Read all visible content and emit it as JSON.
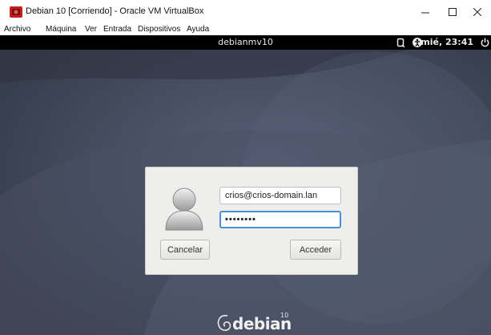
{
  "window": {
    "title": "Debian 10 [Corriendo] - Oracle VM VirtualBox",
    "controls": [
      "minimize-icon",
      "maximize-icon",
      "close-icon"
    ]
  },
  "menu": [
    "Archivo",
    "Máquina",
    "Ver",
    "Entrada",
    "Dispositivos",
    "Ayuda"
  ],
  "topbar": {
    "hostname": "debianmv10",
    "clock": "mié, 23:41",
    "icons": [
      "screen-reader-icon",
      "accessibility-icon",
      "power-icon"
    ]
  },
  "login": {
    "username": "crios@crios-domain.lan",
    "password_mask": "••••••••",
    "cancel_label": "Cancelar",
    "login_label": "Acceder"
  },
  "logo": {
    "text": "debian",
    "superscript": "10"
  },
  "colors": {
    "desktop_bg": "#3f4656",
    "accent": "#4a90d9",
    "debian_red": "#d70751"
  }
}
